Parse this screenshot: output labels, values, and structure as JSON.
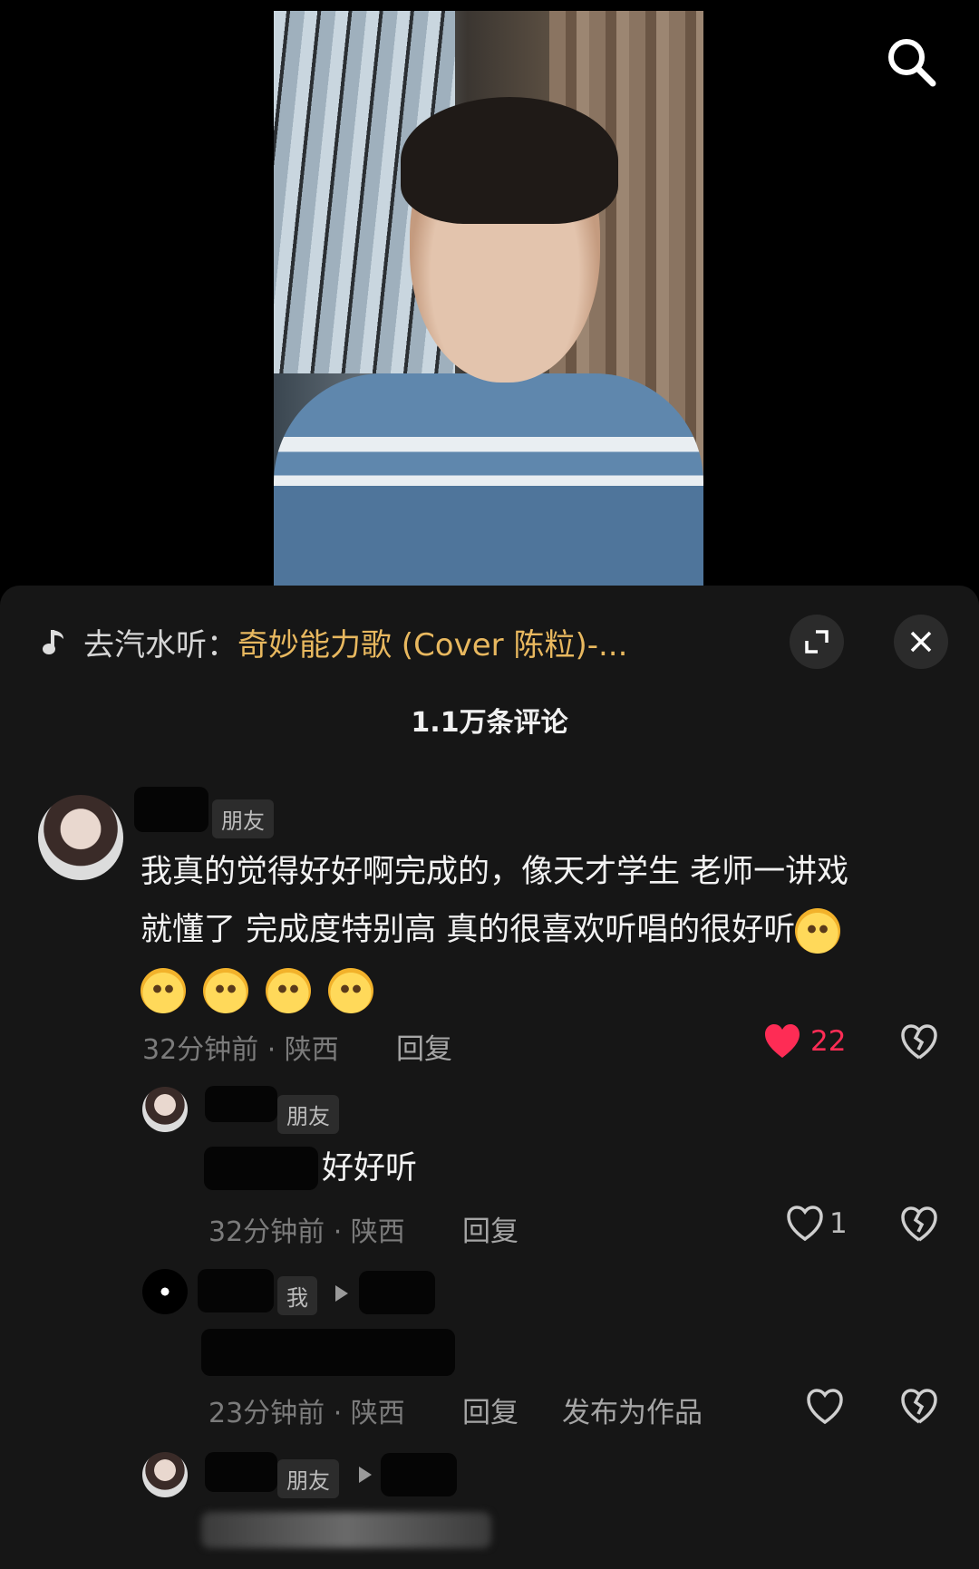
{
  "music_bar": {
    "prefix": "去汽水听：",
    "song": "奇妙能力歌 (Cover 陈粒)-..."
  },
  "comments_count": "1.1万条评论",
  "comments": [
    {
      "tag": "朋友",
      "text_line1": "我真的觉得好好啊完成的，像天才学生 老师一讲戏",
      "text_line2": "就懂了 完成度特别高 真的很喜欢听唱的很好听",
      "time_location": "32分钟前 · 陕西",
      "reply_label": "回复",
      "likes": "22"
    },
    {
      "tag": "朋友",
      "text": "好好听",
      "time_location": "32分钟前 · 陕西",
      "reply_label": "回复",
      "likes": "1"
    },
    {
      "tag": "我",
      "time_location": "23分钟前 · 陕西",
      "reply_label": "回复",
      "publish_label": "发布为作品"
    },
    {
      "tag": "朋友"
    }
  ],
  "colors": {
    "like_active": "#fe2c55",
    "song_title": "#e8b85f",
    "sheet_bg": "#161616"
  }
}
